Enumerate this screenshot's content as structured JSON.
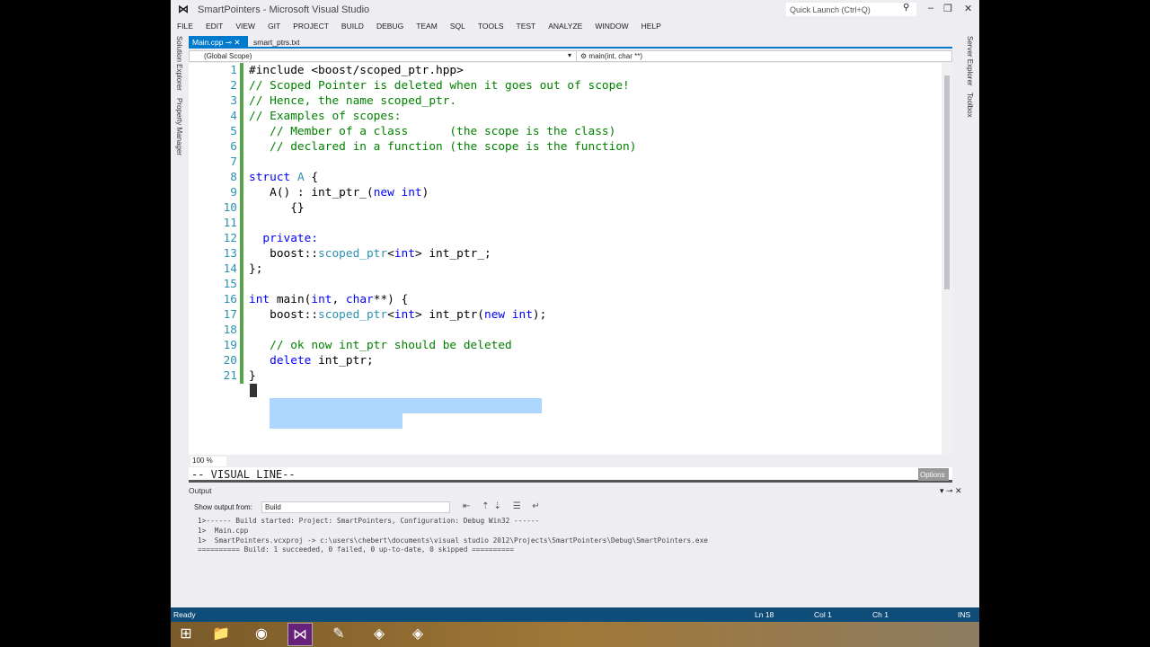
{
  "window": {
    "title": "SmartPointers - Microsoft Visual Studio",
    "quick_launch": "Quick Launch (Ctrl+Q)"
  },
  "menu": [
    "FILE",
    "EDIT",
    "VIEW",
    "GIT",
    "PROJECT",
    "BUILD",
    "DEBUG",
    "TEAM",
    "SQL",
    "TOOLS",
    "TEST",
    "ANALYZE",
    "WINDOW",
    "HELP"
  ],
  "side_tabs": {
    "left": [
      "Solution Explorer",
      "Property Manager"
    ],
    "right": [
      "Server Explorer",
      "Toolbox"
    ]
  },
  "tabs": [
    {
      "label": "Main.cpp",
      "active": true
    },
    {
      "label": "smart_ptrs.txt",
      "active": false
    }
  ],
  "nav": {
    "scope": "(Global Scope)",
    "function": "main(int, char **)"
  },
  "code": [
    [
      [
        "#include <boost/scoped_ptr.hpp>",
        "tx"
      ]
    ],
    [
      [
        "// Scoped Pointer is deleted when it goes out of scope!",
        "cm"
      ]
    ],
    [
      [
        "// Hence, the name scoped_ptr.",
        "cm"
      ]
    ],
    [
      [
        "// Examples of scopes:",
        "cm"
      ]
    ],
    [
      [
        "   // Member of a class      (the scope is the class)",
        "cm"
      ]
    ],
    [
      [
        "   // declared in a function (the scope is the function)",
        "cm"
      ]
    ],
    [],
    [
      [
        "struct ",
        "kw"
      ],
      [
        "A",
        "ty"
      ],
      [
        " {",
        "tx"
      ]
    ],
    [
      [
        "   A() : int_ptr_(",
        "tx"
      ],
      [
        "new int",
        "kw"
      ],
      [
        ")",
        "tx"
      ]
    ],
    [
      [
        "      {}",
        "tx"
      ]
    ],
    [],
    [
      [
        "  private:",
        "kw"
      ]
    ],
    [
      [
        "   boost::",
        "tx"
      ],
      [
        "scoped_ptr",
        "ty"
      ],
      [
        "<",
        "tx"
      ],
      [
        "int",
        "kw"
      ],
      [
        "> int_ptr_;",
        "tx"
      ]
    ],
    [
      [
        "};",
        "tx"
      ]
    ],
    [],
    [
      [
        "int",
        "kw"
      ],
      [
        " main(",
        "tx"
      ],
      [
        "int",
        "kw"
      ],
      [
        ", ",
        "tx"
      ],
      [
        "char",
        "kw"
      ],
      [
        "**) {",
        "tx"
      ]
    ],
    [
      [
        "   boost::",
        "tx"
      ],
      [
        "scoped_ptr",
        "ty"
      ],
      [
        "<",
        "tx"
      ],
      [
        "int",
        "kw"
      ],
      [
        "> int_ptr(",
        "tx"
      ],
      [
        "new int",
        "kw"
      ],
      [
        ");",
        "tx"
      ]
    ],
    [],
    [
      [
        "   // ok now int_ptr should be deleted",
        "cm"
      ]
    ],
    [
      [
        "   ",
        "tx"
      ],
      [
        "delete",
        "kw"
      ],
      [
        " int_ptr;",
        "tx"
      ]
    ],
    [
      [
        "}",
        "tx"
      ]
    ]
  ],
  "editor": {
    "zoom": "100 %"
  },
  "command": {
    "text": "-- VISUAL LINE--",
    "options": "Options"
  },
  "output": {
    "title": "Output",
    "show_from_label": "Show output from:",
    "source": "Build",
    "lines": [
      "1>------ Build started: Project: SmartPointers, Configuration: Debug Win32 ------",
      "1>  Main.cpp",
      "1>  SmartPointers.vcxproj -> c:\\users\\chebert\\documents\\visual studio 2012\\Projects\\SmartPointers\\Debug\\SmartPointers.exe",
      "========== Build: 1 succeeded, 0 failed, 0 up-to-date, 0 skipped =========="
    ]
  },
  "status": {
    "ready": "Ready",
    "ln": "Ln 18",
    "col": "Col 1",
    "ch": "Ch 1",
    "mode": "INS"
  },
  "taskbar": [
    "windows-start",
    "file-explorer",
    "chrome",
    "visual-studio",
    "pen-tool",
    "app-1",
    "app-2"
  ]
}
